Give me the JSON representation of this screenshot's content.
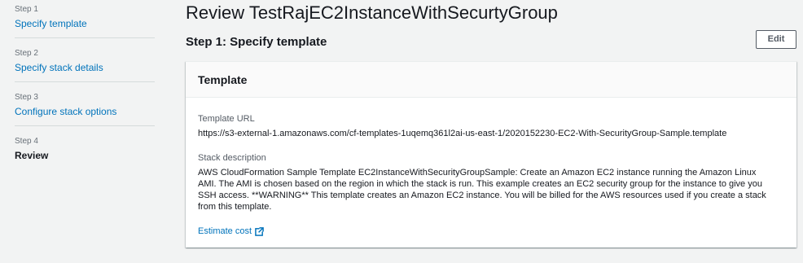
{
  "sidebar": {
    "steps": [
      {
        "number": "Step 1",
        "label": "Specify template"
      },
      {
        "number": "Step 2",
        "label": "Specify stack details"
      },
      {
        "number": "Step 3",
        "label": "Configure stack options"
      },
      {
        "number": "Step 4",
        "label": "Review"
      }
    ]
  },
  "header": {
    "title": "Review TestRajEC2InstanceWithSecurtyGroup"
  },
  "section": {
    "heading": "Step 1: Specify template",
    "edit_label": "Edit"
  },
  "panel": {
    "title": "Template",
    "template_url_label": "Template URL",
    "template_url": "https://s3-external-1.amazonaws.com/cf-templates-1uqemq361l2ai-us-east-1/2020152230-EC2-With-SecurityGroup-Sample.template",
    "stack_description_label": "Stack description",
    "stack_description": "AWS CloudFormation Sample Template EC2InstanceWithSecurityGroupSample: Create an Amazon EC2 instance running the Amazon Linux AMI. The AMI is chosen based on the region in which the stack is run. This example creates an EC2 security group for the instance to give you SSH access. **WARNING** This template creates an Amazon EC2 instance. You will be billed for the AWS resources used if you create a stack from this template.",
    "estimate_cost_label": "Estimate cost",
    "estimate_icon": "external-link-icon"
  },
  "colors": {
    "link": "#0073bb",
    "background": "#f2f3f3",
    "panel": "#ffffff"
  }
}
